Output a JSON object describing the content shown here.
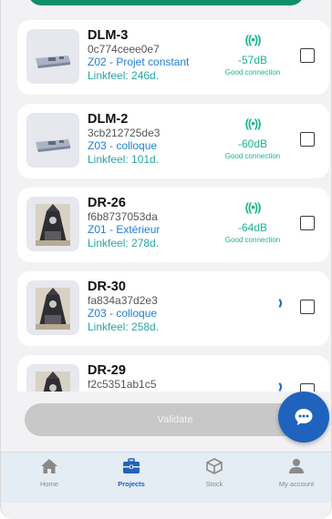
{
  "devices": [
    {
      "name": "DLM-3",
      "mac": "0c774ceee0e7",
      "project": "Z02 - Projet constant",
      "linkfeel": "Linkfeel: 246d.",
      "signal_db": "-57dB",
      "signal_quality": "Good connection",
      "status": "signal",
      "checked": false
    },
    {
      "name": "DLM-2",
      "mac": "3cb212725de3",
      "project": "Z03 - colloque",
      "linkfeel": "Linkfeel: 101d.",
      "signal_db": "-60dB",
      "signal_quality": "Good connection",
      "status": "signal",
      "checked": false
    },
    {
      "name": "DR-26",
      "mac": "f6b8737053da",
      "project": "Z01 - Extérieur",
      "linkfeel": "Linkfeel: 278d.",
      "signal_db": "-64dB",
      "signal_quality": "Good connection",
      "status": "signal",
      "checked": false
    },
    {
      "name": "DR-30",
      "mac": "fa834a37d2e3",
      "project": "Z03 - colloque",
      "linkfeel": "Linkfeel: 258d.",
      "status": "loading",
      "checked": false
    },
    {
      "name": "DR-29",
      "mac": "f2c5351ab1c5",
      "status": "loading",
      "checked": false
    }
  ],
  "signal_icon": "((•))",
  "validate_label": "Validate",
  "chat_fab_icon": "chat-bubble-icon",
  "tabs": [
    {
      "label": "Home",
      "icon": "home-icon",
      "active": false
    },
    {
      "label": "Projects",
      "icon": "briefcase-icon",
      "active": true
    },
    {
      "label": "Stock",
      "icon": "box-icon",
      "active": false
    },
    {
      "label": "My account",
      "icon": "user-icon",
      "active": false
    }
  ],
  "colors": {
    "accent": "#1f63be",
    "signal": "#19b58f",
    "project": "#1e7fd0",
    "linkfeel": "#27a6a0",
    "top_strip": "#0e8f6a"
  }
}
